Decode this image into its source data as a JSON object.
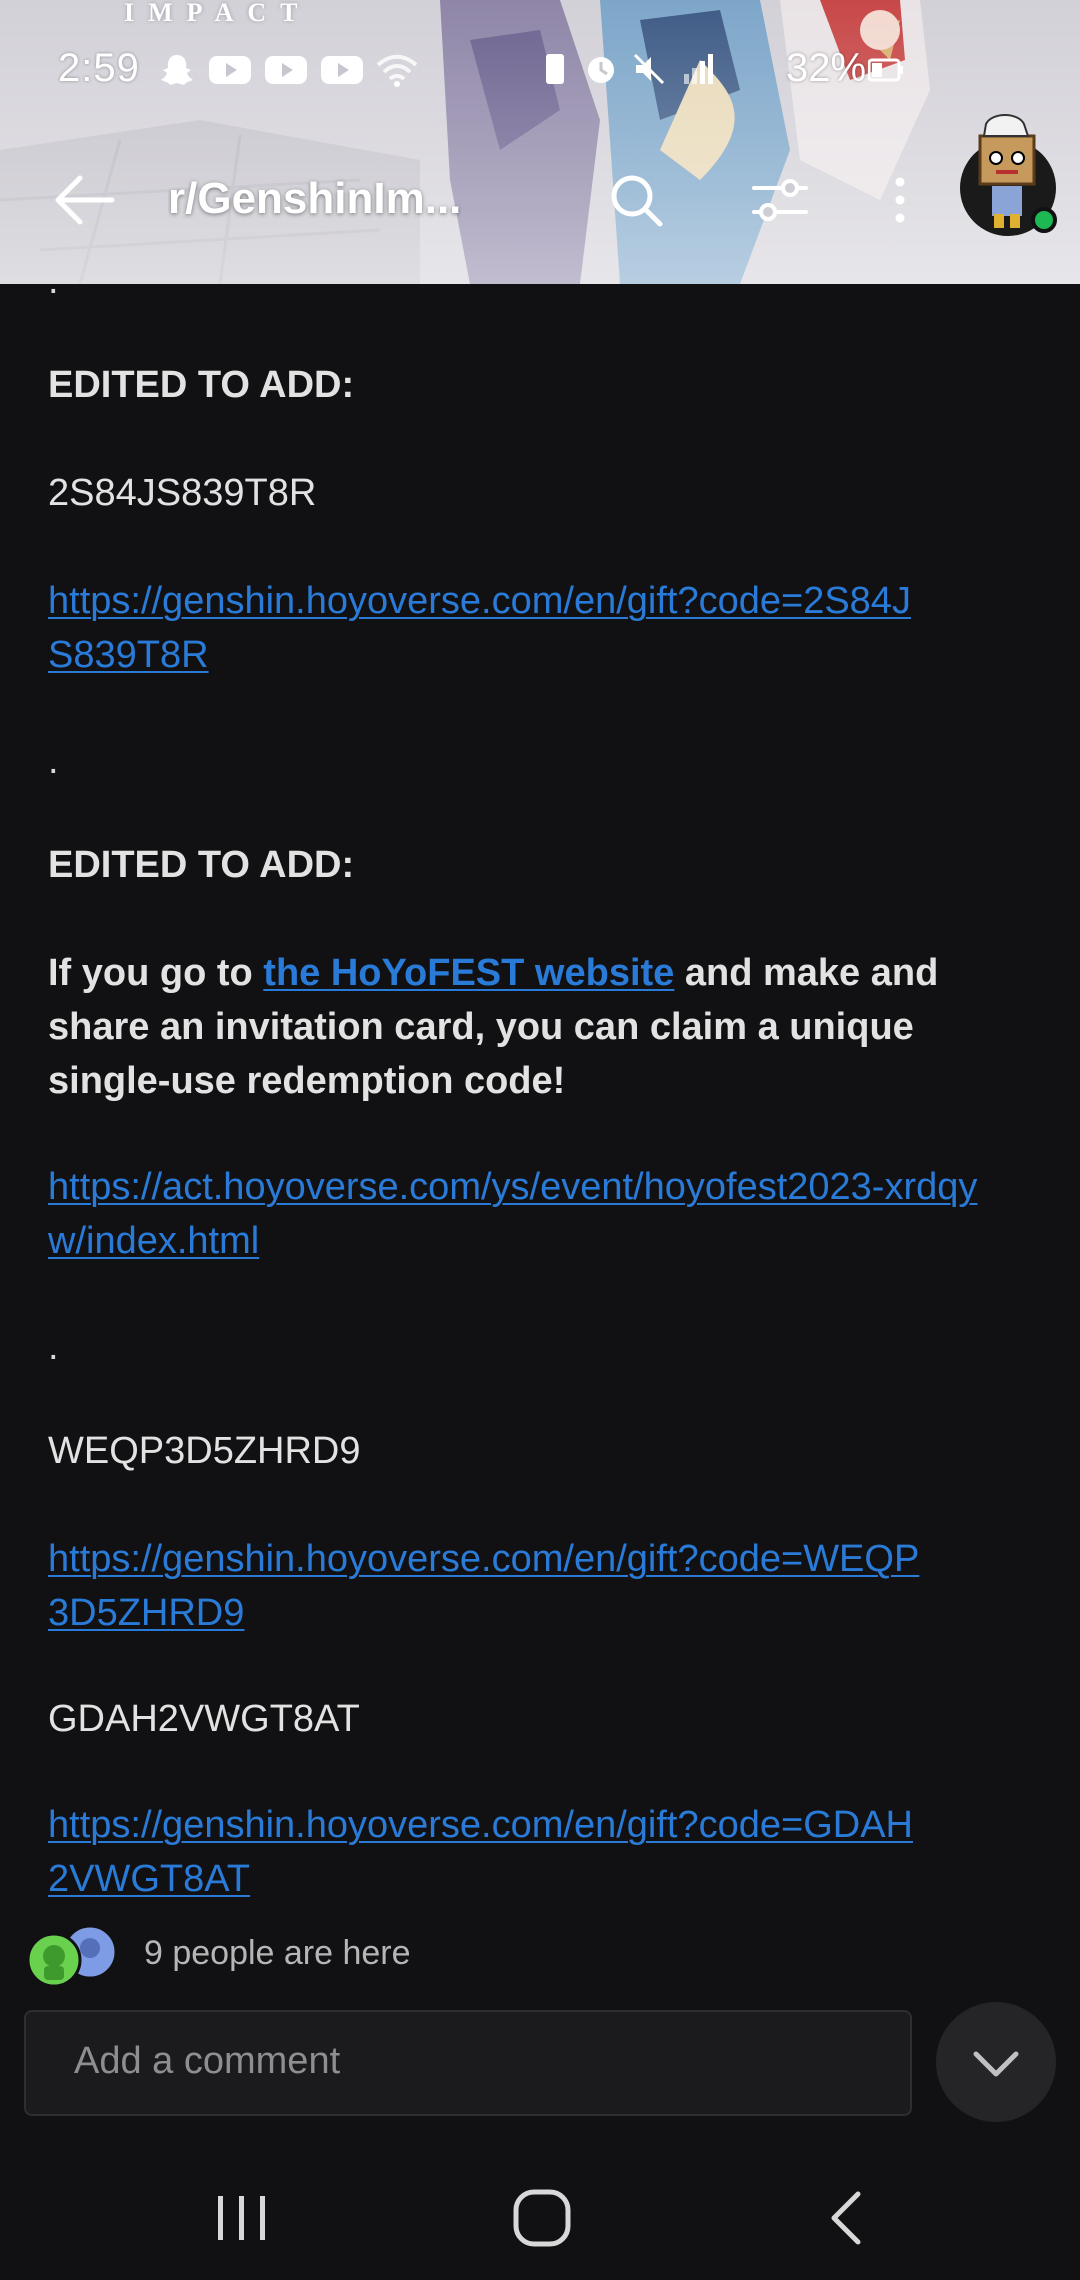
{
  "status_bar": {
    "time": "2:59",
    "battery": "32%",
    "left_icons": [
      "snapchat-icon",
      "youtube-icon",
      "youtube-icon",
      "youtube-icon",
      "wifi-icon"
    ],
    "right_icons": [
      "vibrate-icon",
      "alarm-icon",
      "mute-icon",
      "signal-icon",
      "battery-icon"
    ]
  },
  "header": {
    "game_logo": "IMPACT",
    "subreddit": "r/GenshinIm..."
  },
  "post": {
    "dot1": ".",
    "edit1_heading": "EDITED TO ADD:",
    "code1": "2S84JS839T8R",
    "link1": "https://genshin.hoyoverse.com/en/gift?code=2S84JS839T8R",
    "dot2": ".",
    "edit2_heading": "EDITED TO ADD:",
    "hoyofest_before": "If you go to ",
    "hoyofest_link": "the HoYoFEST website",
    "hoyofest_after": " and make and share an invitation card, you can claim a unique single-use redemption code!",
    "link2": "https://act.hoyoverse.com/ys/event/hoyofest2023-xrdqyw/index.html",
    "dot3": ".",
    "code2": "WEQP3D5ZHRD9",
    "link3": "https://genshin.hoyoverse.com/en/gift?code=WEQP3D5ZHRD9",
    "code3": "GDAH2VWGT8AT",
    "link4": "https://genshin.hoyoverse.com/en/gift?code=GDAH2VWGT8AT"
  },
  "presence": {
    "text": "9 people are here"
  },
  "comment": {
    "placeholder": "Add a comment"
  },
  "colors": {
    "background": "#111113",
    "link": "#2a7bd8",
    "text": "#e2e2e2",
    "online_dot": "#1db954"
  }
}
